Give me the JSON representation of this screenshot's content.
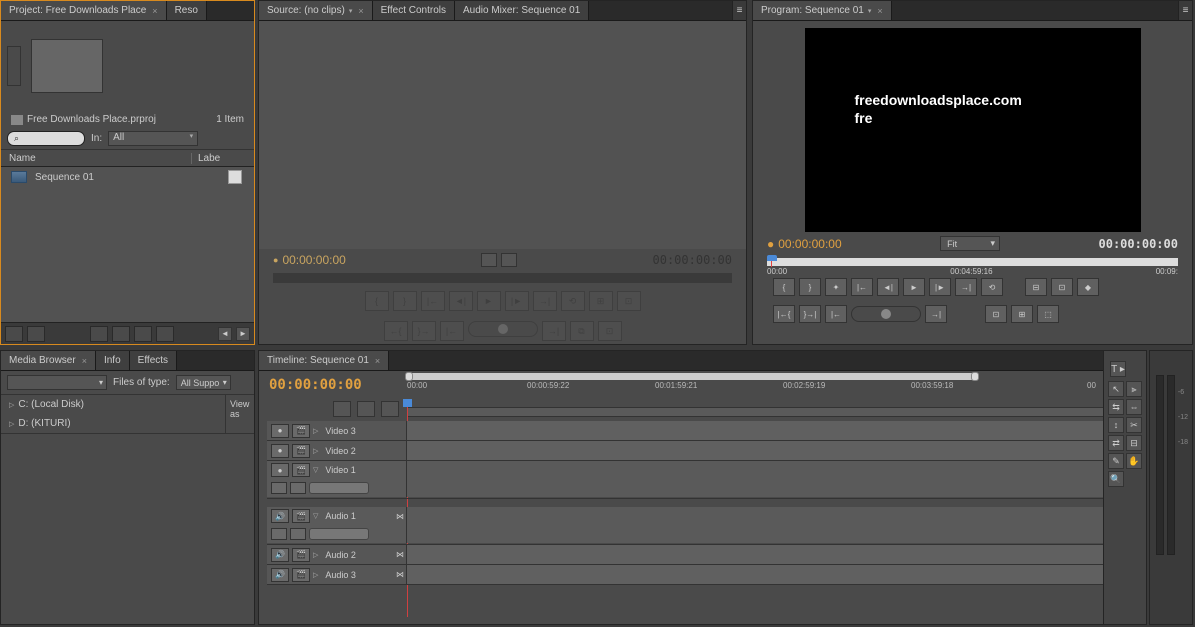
{
  "project": {
    "tab_label": "Project: Free Downloads Place",
    "tab2": "Reso",
    "filename": "Free Downloads Place.prproj",
    "item_count": "1 Item",
    "search_placeholder": "",
    "in_label": "In:",
    "in_value": "All",
    "col_name": "Name",
    "col_label": "Labe",
    "items": [
      {
        "name": "Sequence 01"
      }
    ]
  },
  "source": {
    "tabs": [
      "Source: (no clips)",
      "Effect Controls",
      "Audio Mixer: Sequence 01"
    ],
    "tc_in": "00:00:00:00",
    "tc_out": "00:00:00:00"
  },
  "program": {
    "tab_label": "Program: Sequence 01",
    "watermark": "freedownloadsplace.com",
    "watermark2": "fre",
    "tc_in": "00:00:00:00",
    "tc_out": "00:00:00:00",
    "fit_label": "Fit",
    "ruler": {
      "start": "00:00",
      "mid": "00:04:59:16",
      "end": "00:09:"
    }
  },
  "media": {
    "tabs": [
      "Media Browser",
      "Info",
      "Effects"
    ],
    "files_of_type_label": "Files of type:",
    "files_of_type_value": "All Suppo",
    "view_as": "View as",
    "drives": [
      "C: (Local Disk)",
      "D: (KITURI)"
    ]
  },
  "timeline": {
    "tab_label": "Timeline: Sequence 01",
    "tc": "00:00:00:00",
    "ruler_labels": [
      "00:00",
      "00:00:59:22",
      "00:01:59:21",
      "00:02:59:19",
      "00:03:59:18",
      "00"
    ],
    "video_tracks": [
      "Video 3",
      "Video 2",
      "Video 1"
    ],
    "audio_tracks": [
      "Audio 1",
      "Audio 2",
      "Audio 3"
    ]
  },
  "meters": {
    "labels": [
      "-6",
      "-12",
      "-18"
    ]
  }
}
